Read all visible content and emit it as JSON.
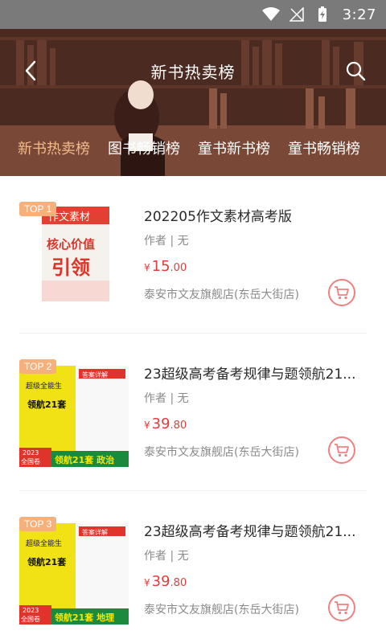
{
  "status_bar": {
    "time": "3:27"
  },
  "header": {
    "title": "新书热卖榜"
  },
  "tabs": [
    {
      "label": "新书热卖榜",
      "active": true
    },
    {
      "label": "图书畅销榜",
      "active": false
    },
    {
      "label": "童书新书榜",
      "active": false
    },
    {
      "label": "童书畅销榜",
      "active": false
    }
  ],
  "books": [
    {
      "rank": "TOP 1",
      "title": "202205作文素材高考版",
      "author": "作者 | 无",
      "price_symbol": "¥",
      "price_int": "15",
      "price_dec": ".00",
      "shop": "泰安市文友旗舰店(东岳大街店)",
      "cover_text": [
        "作文素材",
        "核心价值",
        "引领"
      ]
    },
    {
      "rank": "TOP 2",
      "title": "23超级高考备考规律与题领航21...",
      "author": "作者 | 无",
      "price_symbol": "¥",
      "price_int": "39",
      "price_dec": ".80",
      "shop": "泰安市文友旗舰店(东岳大街店)",
      "cover_text": [
        "超级全能生",
        "领航21套",
        "答案详解",
        "2023",
        "全国卷",
        "领航21套 政治"
      ]
    },
    {
      "rank": "TOP 3",
      "title": "23超级高考备考规律与题领航21...",
      "author": "作者 | 无",
      "price_symbol": "¥",
      "price_int": "39",
      "price_dec": ".80",
      "shop": "泰安市文友旗舰店(东岳大街店)",
      "cover_text": [
        "超级全能生",
        "领航21套",
        "答案详解",
        "2023",
        "全国卷",
        "领航21套 地理"
      ]
    }
  ],
  "colors": {
    "accent_tab": "#f2b98a",
    "price": "#e33b3b",
    "badge": "#f6b07c",
    "cart": "#f08080"
  }
}
